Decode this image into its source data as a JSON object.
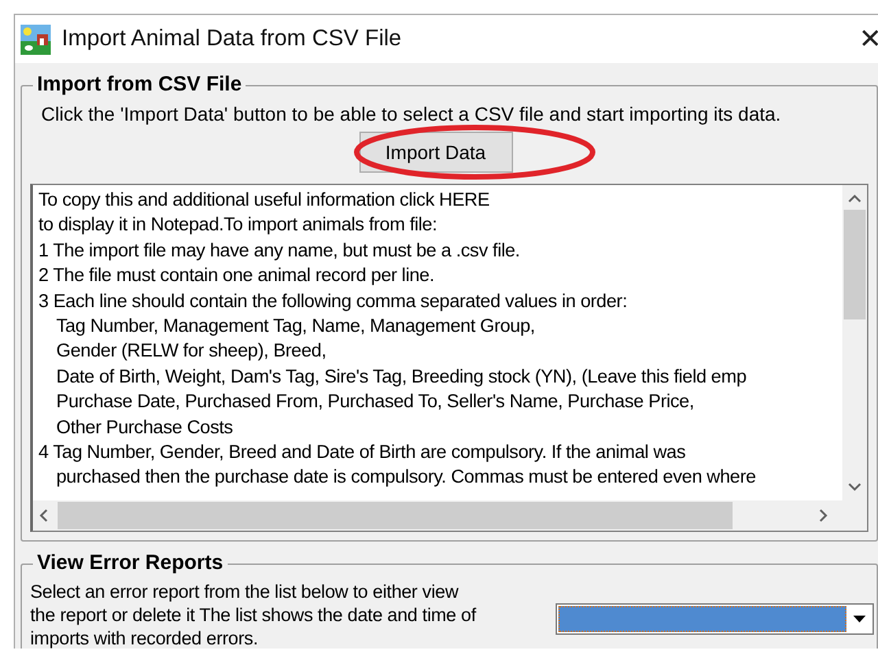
{
  "window": {
    "title": "Import Animal Data from CSV File",
    "close": "✕"
  },
  "import_group": {
    "title": "Import from CSV File",
    "instruction": "Click the 'Import Data' button to be able to select a CSV file and start importing its data.",
    "button": "Import Data"
  },
  "info_text": {
    "lines": [
      {
        "text": "To copy this and additional useful information click HERE",
        "indented": false
      },
      {
        "text": "to display it in Notepad.To import animals from file:",
        "indented": false
      },
      {
        "text": "1 The import file may have any name, but must be a .csv file.",
        "indented": false
      },
      {
        "text": "2 The file must contain one animal record per line.",
        "indented": false
      },
      {
        "text": "3 Each line should contain the following comma separated values in order:",
        "indented": false
      },
      {
        "text": "Tag Number, Management Tag, Name, Management Group,",
        "indented": true
      },
      {
        "text": "Gender (RELW for sheep), Breed,",
        "indented": true
      },
      {
        "text": "Date of Birth, Weight, Dam's Tag, Sire's Tag, Breeding stock (YN), (Leave this field emp",
        "indented": true
      },
      {
        "text": "Purchase Date, Purchased From, Purchased To, Seller's Name, Purchase Price,",
        "indented": true
      },
      {
        "text": "Other Purchase Costs",
        "indented": true
      },
      {
        "text": "4 Tag Number, Gender, Breed and Date of Birth are compulsory. If the animal was",
        "indented": false
      },
      {
        "text": "purchased then the purchase date is compulsory. Commas must be entered even where",
        "indented": true
      }
    ]
  },
  "error_group": {
    "title": "View Error Reports",
    "description": "Select an error report from the list below to either view the report or delete it The list shows the date and time of imports with recorded errors.",
    "dropdown": {
      "highlighted": true
    }
  }
}
